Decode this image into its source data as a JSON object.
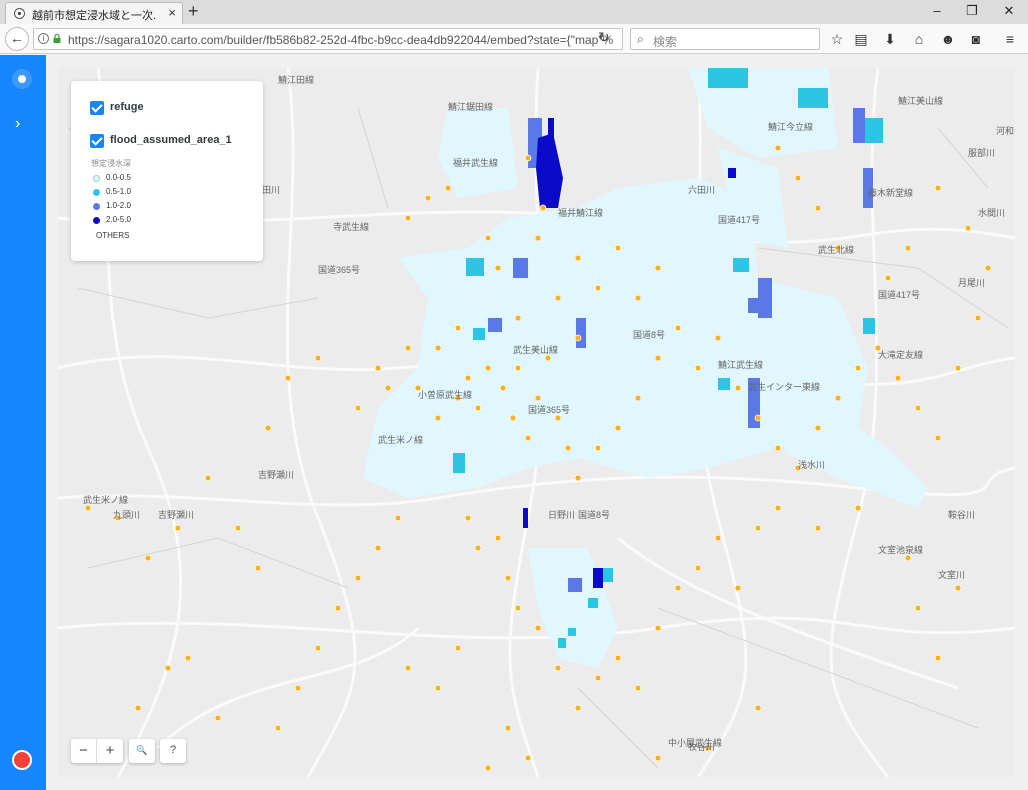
{
  "browser": {
    "tab_title": "越前市想定浸水域と一次...",
    "tab_close": "×",
    "new_tab": "+",
    "url": "https://sagara1020.carto.com/builder/fb586b82-252d-4fbc-b9cc-dea4db922044/embed?state={\"map\"%",
    "search_placeholder": "検索",
    "window_buttons": [
      "–",
      "❐",
      "✕"
    ]
  },
  "legend": {
    "layers": [
      {
        "name": "refuge",
        "checked": true
      },
      {
        "name": "flood_assumed_area_1",
        "checked": true
      }
    ],
    "title": "想定浸水深",
    "items": [
      {
        "label": "0.0-0.5",
        "color": "#e0f7ff"
      },
      {
        "label": "0.5-1.0",
        "color": "#2ec4e6"
      },
      {
        "label": "1.0-2.0",
        "color": "#5a78e6"
      },
      {
        "label": "2.0-5.0",
        "color": "#0a0ac8"
      }
    ],
    "others": "OTHERS"
  },
  "controls": {
    "zoom_out": "−",
    "zoom_in": "+",
    "search": "🔍",
    "help": "?"
  },
  "colors": {
    "sidebar": "#1785fb",
    "refuge_point": "#fbb11a",
    "map_background": "#ececec"
  },
  "map_labels": [
    "鯖江鋸田線",
    "福井鯖江線",
    "鯖江今立線",
    "鯖江美山線",
    "河和",
    "福井武生線",
    "寺武生線",
    "国道365号",
    "武生美山線",
    "国道8号",
    "武生インター東線",
    "鯖江武生線",
    "国道417号",
    "武生米ノ線",
    "小曽原武生線",
    "国道365号",
    "吉野瀬川",
    "九頭川",
    "吉野瀬川",
    "文室池泉線",
    "文室川",
    "中小屋武生線",
    "牧谷川",
    "武生米ノ線",
    "和田川",
    "浅水川",
    "日野川",
    "服部川",
    "水間川",
    "月尾川",
    "藤木新堂線",
    "大滝定友線",
    "武生北線",
    "鞍谷川",
    "鯖江田線",
    "六田川",
    "国道417号",
    "国道8号"
  ]
}
